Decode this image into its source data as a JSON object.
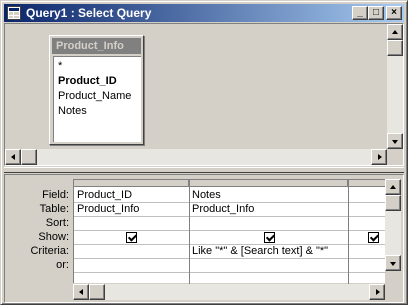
{
  "window": {
    "title": "Query1 : Select Query",
    "controls": {
      "minimize": "_",
      "maximize": "□",
      "close": "×"
    }
  },
  "field_list": {
    "title": "Product_Info",
    "fields": [
      "*",
      "Product_ID",
      "Product_Name",
      "Notes"
    ],
    "primary_key": "Product_ID"
  },
  "design_grid": {
    "row_labels": [
      "Field:",
      "Table:",
      "Sort:",
      "Show:",
      "Criteria:",
      "or:"
    ],
    "columns": [
      {
        "field": "Product_ID",
        "table": "Product_Info",
        "sort": "",
        "show": true,
        "criteria": "",
        "or": ""
      },
      {
        "field": "Notes",
        "table": "Product_Info",
        "sort": "",
        "show": true,
        "criteria": "Like \"*\" & [Search text] & \"*\"",
        "or": ""
      },
      {
        "field": "",
        "table": "",
        "sort": "",
        "show": true,
        "criteria": "",
        "or": ""
      }
    ]
  },
  "colors": {
    "title_active_start": "#0a246a",
    "title_active_end": "#a6caf0",
    "chrome": "#d4d0c8"
  }
}
